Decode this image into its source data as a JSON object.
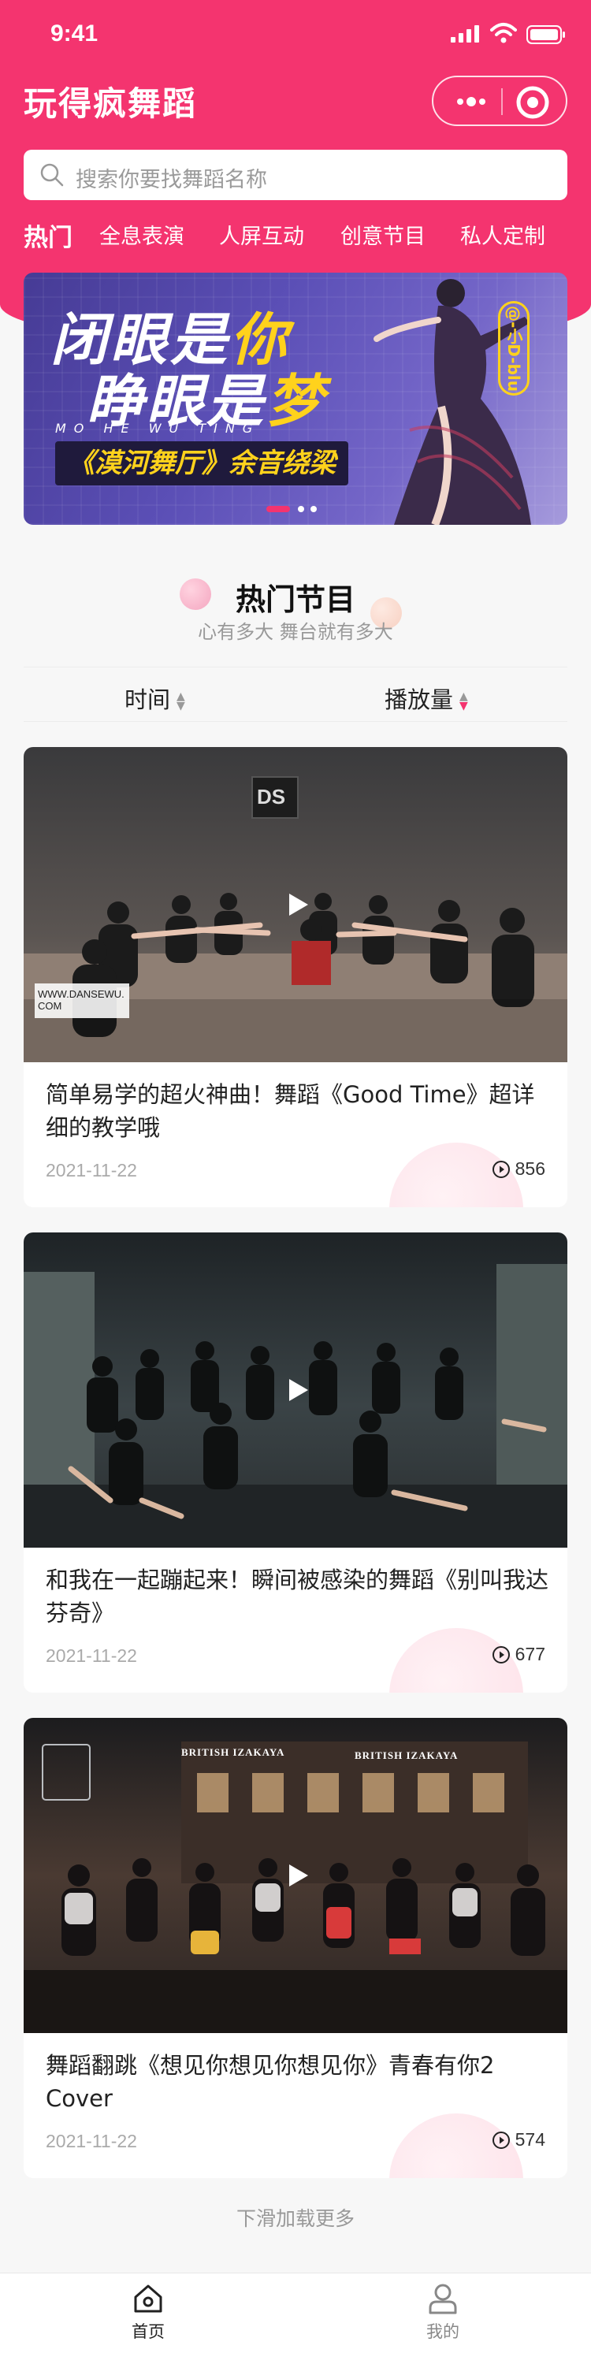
{
  "status_bar": {
    "time": "9:41"
  },
  "header": {
    "app_title": "玩得疯舞蹈"
  },
  "search": {
    "placeholder": "搜索你要找舞蹈名称"
  },
  "tabs": [
    {
      "label": "热门",
      "active": true
    },
    {
      "label": "全息表演"
    },
    {
      "label": "人屏互动"
    },
    {
      "label": "创意节目"
    },
    {
      "label": "私人定制"
    }
  ],
  "banner": {
    "line1_pre": "闭眼是",
    "line1_hl": "你",
    "line2_pre": "睁眼是",
    "line2_hl": "梦",
    "sub": "MO HE WU TING",
    "tag": "《漠河舞厅》余音绕梁",
    "handle": "@-小D-blu",
    "slide_count": 3,
    "active_slide": 0
  },
  "section": {
    "title": "热门节目",
    "subtitle": "心有多大 舞台就有多大"
  },
  "sort": {
    "time_label": "时间",
    "plays_label": "播放量"
  },
  "cards": [
    {
      "title": "简单易学的超火神曲！舞蹈《Good Time》超详细的教学哦",
      "date": "2021-11-22",
      "views": "856",
      "watermark": "WWW.DANSEWU.COM",
      "sign": "DS"
    },
    {
      "title": "和我在一起蹦起来！瞬间被感染的舞蹈《别叫我达芬奇》",
      "date": "2021-11-22",
      "views": "677"
    },
    {
      "title": "舞蹈翻跳《想见你想见你想见你》青春有你2 Cover",
      "date": "2021-11-22",
      "views": "574",
      "sign_left": "BRITISH IZAKAYA",
      "sign_right": "BRITISH IZAKAYA"
    }
  ],
  "load_more": "下滑加载更多",
  "tabbar": [
    {
      "label": "首页",
      "icon": "home-icon",
      "active": true
    },
    {
      "label": "我的",
      "icon": "user-icon",
      "active": false
    }
  ],
  "colors": {
    "primary": "#f4346f",
    "banner": "#5b4fb6",
    "highlight": "#ffd21c"
  }
}
